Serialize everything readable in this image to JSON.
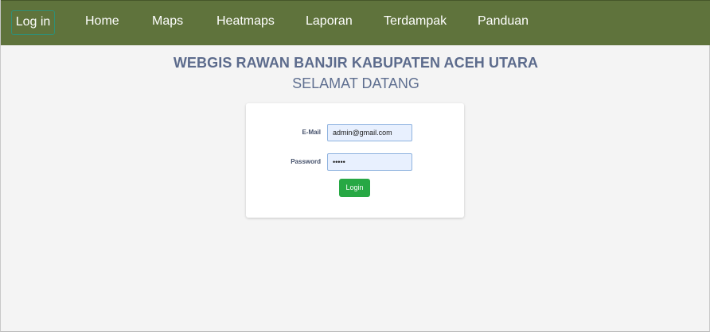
{
  "navbar": {
    "login": "Log in",
    "items": [
      {
        "label": "Home"
      },
      {
        "label": "Maps"
      },
      {
        "label": "Heatmaps"
      },
      {
        "label": "Laporan"
      },
      {
        "label": "Terdampak"
      },
      {
        "label": "Panduan"
      }
    ]
  },
  "header": {
    "title": "WEBGIS RAWAN BANJIR KABUPATEN ACEH UTARA",
    "subtitle": "SELAMAT DATANG"
  },
  "form": {
    "email_label": "E-Mail",
    "email_value": "admin@gmail.com",
    "password_label": "Password",
    "password_value": "•••••",
    "login_button": "Login"
  },
  "colors": {
    "navbar": "#5f733c",
    "button": "#27a844",
    "title": "#5c6b8c"
  }
}
